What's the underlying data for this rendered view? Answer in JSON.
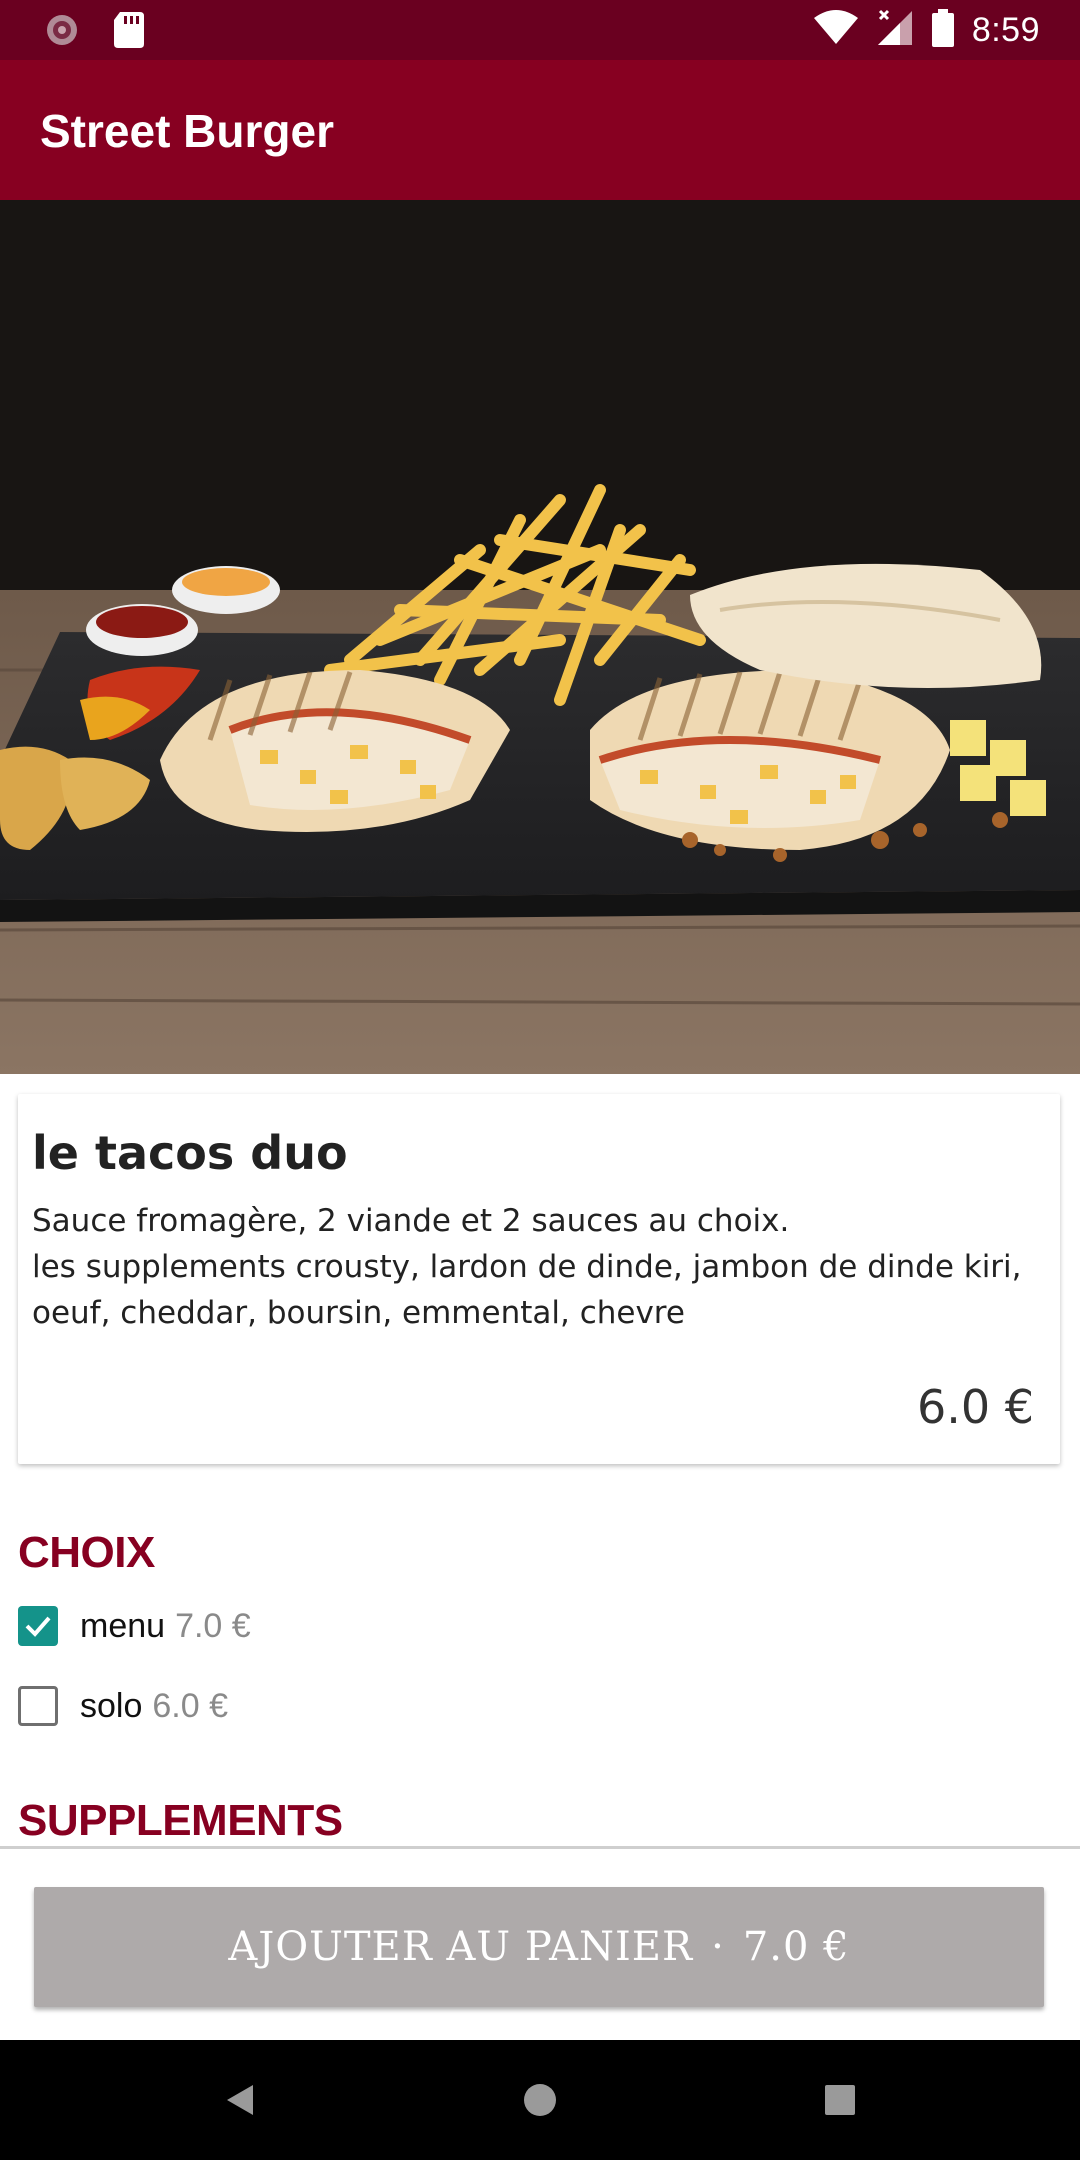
{
  "status_bar": {
    "time": "8:59",
    "icons": [
      "notification-icon",
      "sd-card-icon",
      "wifi-icon",
      "cell-signal-icon",
      "battery-icon"
    ]
  },
  "app_bar": {
    "title": "Street Burger",
    "color": "#870021"
  },
  "hero": {
    "image": "tacos-photo"
  },
  "product": {
    "name": "le tacos duo",
    "description": "Sauce fromagère, 2 viande et 2 sauces au choix.\n les supplements crousty, lardon de dinde, jambon de dinde kiri, oeuf, cheddar, boursin, emmental, chevre",
    "price": "6.0 €"
  },
  "choix": {
    "title": "CHOIX",
    "options": [
      {
        "label": "menu",
        "price": "7.0 €",
        "checked": true
      },
      {
        "label": "solo",
        "price": "6.0 €",
        "checked": false
      }
    ]
  },
  "supplements": {
    "title": "SUPPLEMENTS"
  },
  "cart_button": {
    "label": "AJOUTER AU PANIER",
    "separator": "·",
    "total": "7.0 €"
  },
  "nav_bar": {
    "icons": [
      "back-icon",
      "home-icon",
      "recents-icon"
    ]
  },
  "colors": {
    "accent": "#870021",
    "status_bar": "#6a0020",
    "checkbox": "#14938a",
    "button_disabled": "#aeaaaa"
  }
}
